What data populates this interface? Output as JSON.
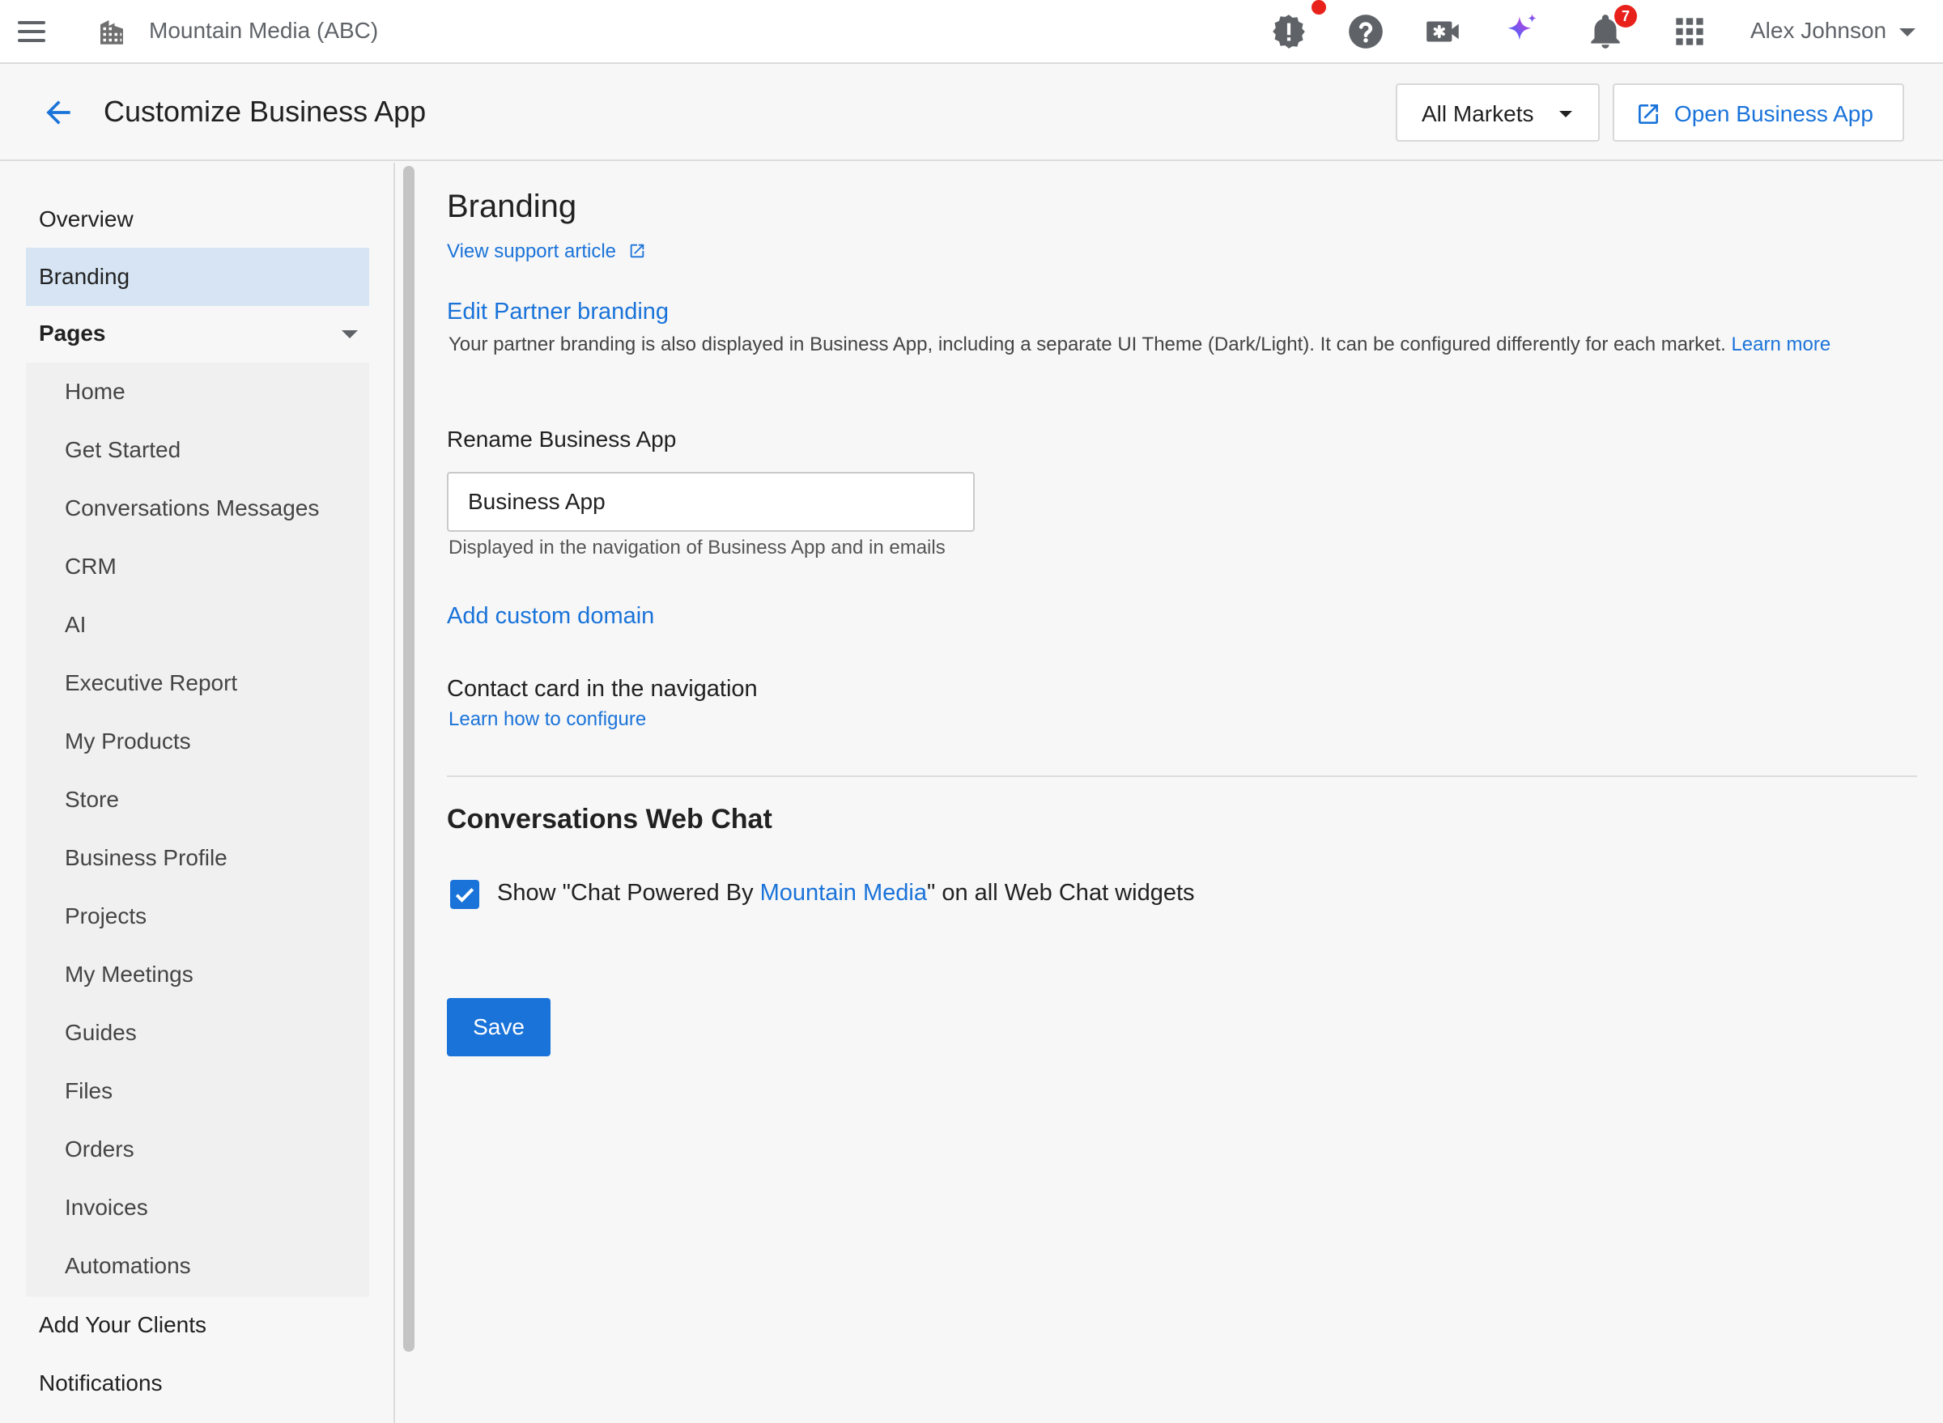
{
  "topbar": {
    "org_name": "Mountain Media (ABC)",
    "notification_count": "7",
    "user_name": "Alex Johnson",
    "icons": [
      "menu-icon",
      "building-icon",
      "alert-icon",
      "help-icon",
      "video-icon",
      "sparkle-icon",
      "bell-icon",
      "apps-grid-icon",
      "caret-down-icon"
    ]
  },
  "header": {
    "title": "Customize Business App",
    "markets_label": "All Markets",
    "open_label": "Open Business App"
  },
  "sidebar": {
    "items_top": [
      {
        "label": "Overview"
      },
      {
        "label": "Branding"
      },
      {
        "label": "Pages"
      }
    ],
    "pages": [
      {
        "label": "Home"
      },
      {
        "label": "Get Started"
      },
      {
        "label": "Conversations Messages"
      },
      {
        "label": "CRM"
      },
      {
        "label": "AI"
      },
      {
        "label": "Executive Report"
      },
      {
        "label": "My Products"
      },
      {
        "label": "Store"
      },
      {
        "label": "Business Profile"
      },
      {
        "label": "Projects"
      },
      {
        "label": "My Meetings"
      },
      {
        "label": "Guides"
      },
      {
        "label": "Files"
      },
      {
        "label": "Orders"
      },
      {
        "label": "Invoices"
      },
      {
        "label": "Automations"
      }
    ],
    "items_bottom": [
      {
        "label": "Add Your Clients"
      },
      {
        "label": "Notifications"
      }
    ]
  },
  "branding": {
    "title": "Branding",
    "support_link": "View support article",
    "edit_partner_link": "Edit Partner branding",
    "description": "Your partner branding is also displayed in Business App, including a separate UI Theme (Dark/Light). It can be configured differently for each market.",
    "learn_more": "Learn more",
    "rename_label": "Rename Business App",
    "rename_value": "Business App",
    "rename_hint": "Displayed in the navigation of Business App and in emails",
    "domain_link": "Add custom domain",
    "contact_label": "Contact card in the navigation",
    "configure_link": "Learn how to configure"
  },
  "web_chat": {
    "title": "Conversations Web Chat",
    "checked": true,
    "label_prefix": "Show \"Chat Powered By ",
    "label_brand": "Mountain Media",
    "label_suffix": "\" on all Web Chat widgets"
  },
  "save_label": "Save",
  "colors": {
    "accent": "#1a73d9",
    "active_nav": "#d6e4f3",
    "badge": "#e8221b",
    "sparkle_start": "#2f6bff",
    "sparkle_end": "#d63cd8"
  }
}
